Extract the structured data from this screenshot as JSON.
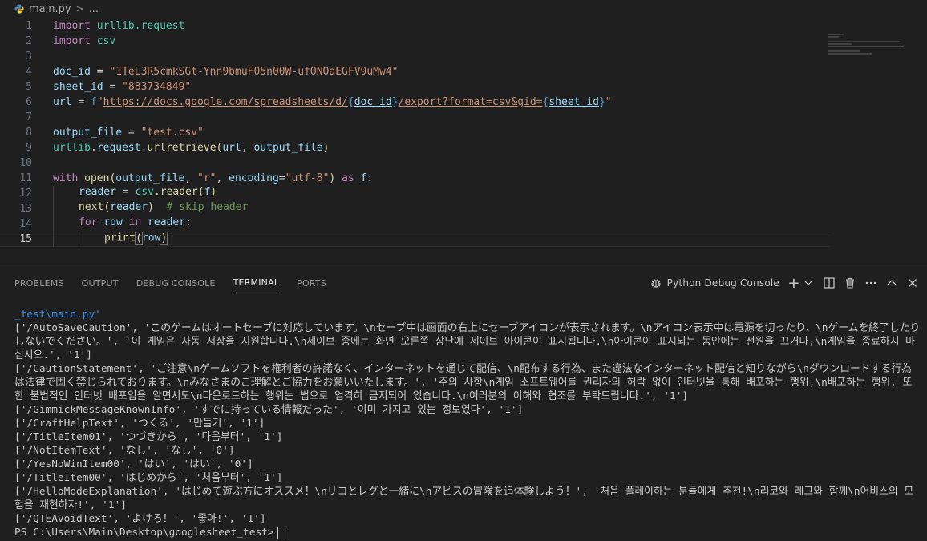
{
  "breadcrumb": {
    "file": "main.py",
    "separator": ">",
    "more": "..."
  },
  "editor": {
    "lines": [
      {
        "n": "1"
      },
      {
        "n": "2"
      },
      {
        "n": "3"
      },
      {
        "n": "4"
      },
      {
        "n": "5"
      },
      {
        "n": "6"
      },
      {
        "n": "7"
      },
      {
        "n": "8"
      },
      {
        "n": "9"
      },
      {
        "n": "10"
      },
      {
        "n": "11"
      },
      {
        "n": "12"
      },
      {
        "n": "13"
      },
      {
        "n": "14"
      },
      {
        "n": "15"
      }
    ],
    "code": {
      "l1_kw": "import",
      "l1_mod": "urllib.request",
      "l2_kw": "import",
      "l2_mod": "csv",
      "l4_var": "doc_id",
      "l4_op": " = ",
      "l4_str": "\"1TeL3R5cmkSGt-Ynn9bmuF05n00W-ufONOaEGFV9uMw4\"",
      "l5_var": "sheet_id",
      "l5_op": " = ",
      "l5_str": "\"883734849\"",
      "l6_var": "url",
      "l6_op": " = ",
      "l6_f": "f",
      "l6_q1": "\"",
      "l6_url": "https://docs.google.com/spreadsheets/d/",
      "l6_b1": "{",
      "l6_v1": "doc_id",
      "l6_b2": "}",
      "l6_mid": "/export?format=csv&gid=",
      "l6_b3": "{",
      "l6_v2": "sheet_id",
      "l6_b4": "}",
      "l6_q2": "\"",
      "l8_var": "output_file",
      "l8_op": " = ",
      "l8_str": "\"test.csv\"",
      "l9_mod": "urllib",
      "l9_dot1": ".",
      "l9_var1": "request",
      "l9_dot2": ".",
      "l9_fn": "urlretrieve",
      "l9_p1": "(",
      "l9_a1": "url",
      "l9_c": ", ",
      "l9_a2": "output_file",
      "l9_p2": ")",
      "l11_kw": "with",
      "l11_fn": "open",
      "l11_p1": "(",
      "l11_a1": "output_file",
      "l11_c1": ", ",
      "l11_s1": "\"r\"",
      "l11_c2": ", ",
      "l11_a2": "encoding",
      "l11_eq": "=",
      "l11_s2": "\"utf-8\"",
      "l11_p2": ")",
      "l11_kw2": "as",
      "l11_v": "f",
      "l11_colon": ":",
      "l12_var": "reader",
      "l12_op": " = ",
      "l12_mod": "csv",
      "l12_dot": ".",
      "l12_fn": "reader",
      "l12_p1": "(",
      "l12_a": "f",
      "l12_p2": ")",
      "l13_fn": "next",
      "l13_p1": "(",
      "l13_a": "reader",
      "l13_p2": ")",
      "l13_cmt": "# skip header",
      "l14_kw": "for",
      "l14_v": "row",
      "l14_kw2": "in",
      "l14_a": "reader",
      "l14_colon": ":",
      "l15_fn": "print",
      "l15_p1": "(",
      "l15_a": "row",
      "l15_p2": ")"
    }
  },
  "panel": {
    "tabs": [
      "PROBLEMS",
      "OUTPUT",
      "DEBUG CONSOLE",
      "TERMINAL",
      "PORTS"
    ],
    "active_tab": "TERMINAL",
    "terminal_profile": "Python Debug Console"
  },
  "terminal": {
    "lines": [
      "_test\\main.py'",
      "['/AutoSaveCaution', 'このゲームはオートセーブに対応しています。\\nセーブ中は画面の右上にセーブアイコンが表示されます。\\nアイコン表示中は電源を切ったり、\\nゲームを終了したりしないでください。', '이 게임은 자동 저장을 지원합니다.\\n세이브 중에는 화면 오른쪽 상단에 세이브 아이콘이 표시됩니다.\\n아이콘이 표시되는 동안에는 전원을 끄거나,\\n게임을 종료하지 마십시오.', '1']",
      "['/CautionStatement', 'ご注意\\nゲームソフトを権利者の許諾なく、インターネットを通じて配信、\\n配布する行為、また違法なインターネット配信と知りながら\\nダウンロードする行為は法律で固く禁じられております。\\nみなさまのご理解とご協力をお願いいたします。', '주의 사항\\n게임 소프트웨어를 권리자의 허락 없이 인터넷을 통해 배포하는 행위,\\n배포하는 행위, 또한 불법적인 인터넷 배포임을 알면서도\\n다운로드하는 행위는 법으로 엄격히 금지되어 있습니다.\\n여러분의 이해와 협조를 부탁드립니다.', '1']",
      "['/GimmickMessageKnownInfo', 'すでに持っている情報だった', '이미 가지고 있는 정보였다', '1']",
      "['/CraftHelpText', 'つくる', '만들기', '1']",
      "['/TitleItem01', 'つづきから', '다음부터', '1']",
      "['/NotItemText', 'なし', 'なし', '0']",
      "['/YesNoWinItem00', 'はい', 'はい', '0']",
      "['/TitleItem00', 'はじめから', '처음부터', '1']",
      "['/HelloModeExplanation', 'はじめて遊ぶ方にオススメ！\\nリコとレグと一緒に\\nアビスの冒険を追体験しよう！', '처음 플레이하는 분들에게 추천!\\n리코와 레그와 함께\\n어비스의 모험을 재현하자!', '1']",
      "['/QTEAvoidText', 'よけろ！', '좋아!', '1']",
      "PS C:\\Users\\Main\\Desktop\\googlesheet_test>"
    ]
  },
  "colors": {
    "background": "#1f1f1f",
    "keyword": "#c586c0",
    "variable": "#9cdcfe",
    "function": "#dcdcaa",
    "string": "#ce9178",
    "comment": "#6a9955",
    "brace": "#569cd6"
  }
}
